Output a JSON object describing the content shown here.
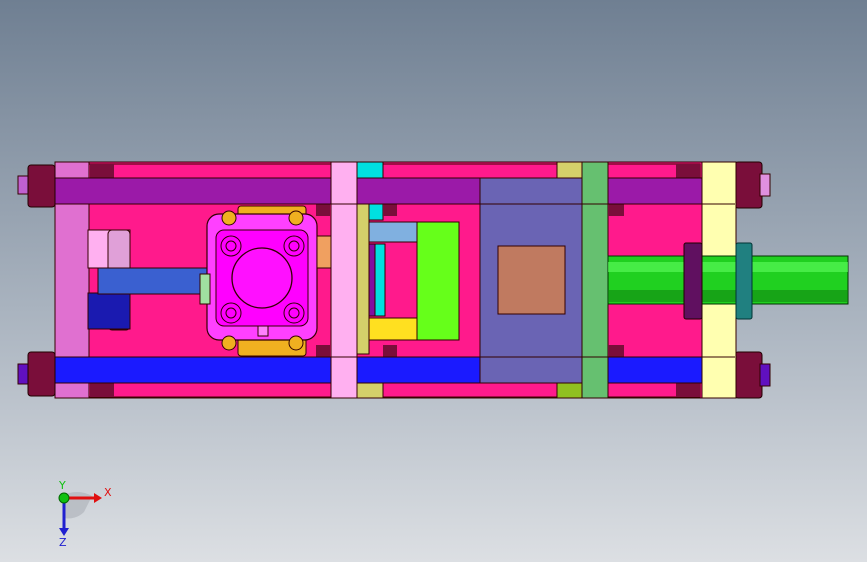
{
  "viewport": {
    "background_top": "#6f7f92",
    "background_bottom": "#dcdfe3"
  },
  "triad": {
    "x_label": "X",
    "z_label": "Z",
    "y_label": "Y",
    "x_color": "#e01010",
    "z_color": "#2020d0",
    "y_color": "#10c010"
  },
  "colors": {
    "frame_magenta": "#ff1a8c",
    "rod_purple": "#9b1aa8",
    "rod_blue": "#1a1aff",
    "nut_dark": "#7a0e3a",
    "plate_pink": "#e070d0",
    "plate_lightpink": "#ffb0f0",
    "plate_cyan": "#00e0e0",
    "plate_olive": "#d4d06a",
    "plate_green": "#66c070",
    "plate_cream": "#ffffb0",
    "block_slate": "#6a64b4",
    "block_brown": "#c07a60",
    "cylinder_green": "#20d020",
    "cylinder_teal": "#208080",
    "clamp_magenta": "#ff00ff",
    "clamp_orange": "#f0b020",
    "lime": "#66ff1a",
    "yellow": "#ffe020"
  }
}
